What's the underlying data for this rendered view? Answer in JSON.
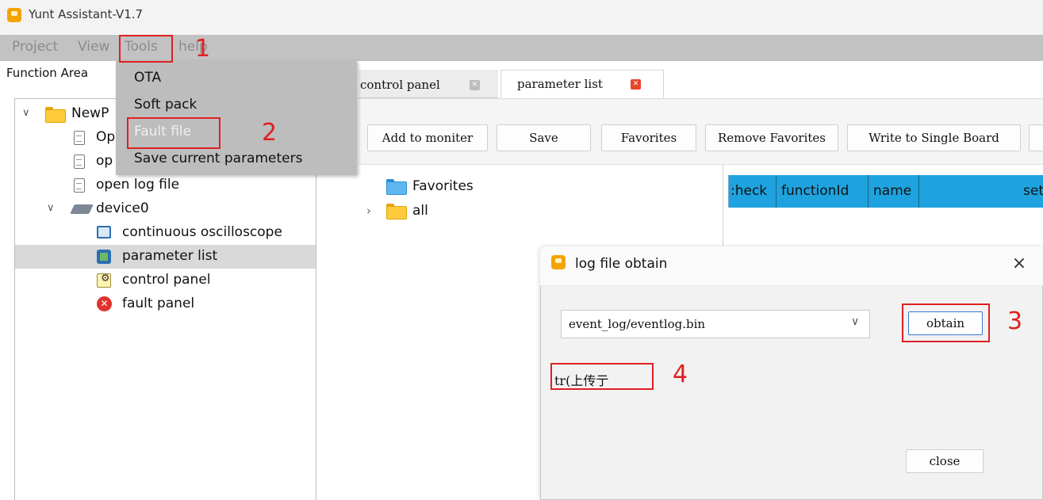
{
  "window": {
    "title": "Yunt Assistant-V1.7"
  },
  "menu": [
    "Project",
    "View",
    "Tools",
    "help"
  ],
  "tools_menu": {
    "items": [
      "OTA",
      "Soft pack",
      "Fault file",
      "Save current parameters"
    ],
    "disabled_item": "Fault file"
  },
  "function_area": {
    "label": "Function Area",
    "tree": {
      "project": "NewP",
      "file_item_1": "Op",
      "file_item_2": "op",
      "open_log_file": "open log file",
      "device": "device0",
      "device_children": [
        "continuous oscilloscope",
        "parameter list",
        "control panel",
        "fault panel"
      ],
      "selected": "parameter list"
    }
  },
  "tabs": [
    {
      "label": "control panel",
      "active": false
    },
    {
      "label": "parameter list",
      "active": true
    }
  ],
  "toolbar": [
    "Add to moniter",
    "Save",
    "Favorites",
    "Remove Favorites",
    "Write to Single Board"
  ],
  "param_tree": {
    "favorites": "Favorites",
    "all": "all"
  },
  "table": {
    "columns": [
      ":heck",
      "functionId",
      "name",
      "set"
    ]
  },
  "dialog": {
    "title": "log file obtain",
    "close_icon": "×",
    "file_select": "event_log/eventlog.bin",
    "obtain_button": "obtain",
    "status": "tr(上传亍",
    "close_button": "close"
  },
  "annotations": [
    "1",
    "2",
    "3",
    "4"
  ],
  "colors": {
    "menubar": "#c2c2c2",
    "dropdown": "#bdbdbd",
    "table_header": "#1ea3de",
    "annotation": "#e02020",
    "selected_row": "#d9d9d9",
    "tab_close": "#e8442c"
  },
  "icons": {
    "app": "app-logo-icon",
    "folder": "folder-icon",
    "document": "document-icon",
    "device": "device-icon",
    "oscilloscope": "oscilloscope-icon",
    "parameter_list": "parameter-list-icon",
    "control_panel": "control-panel-icon",
    "fault_panel": "fault-panel-icon"
  }
}
